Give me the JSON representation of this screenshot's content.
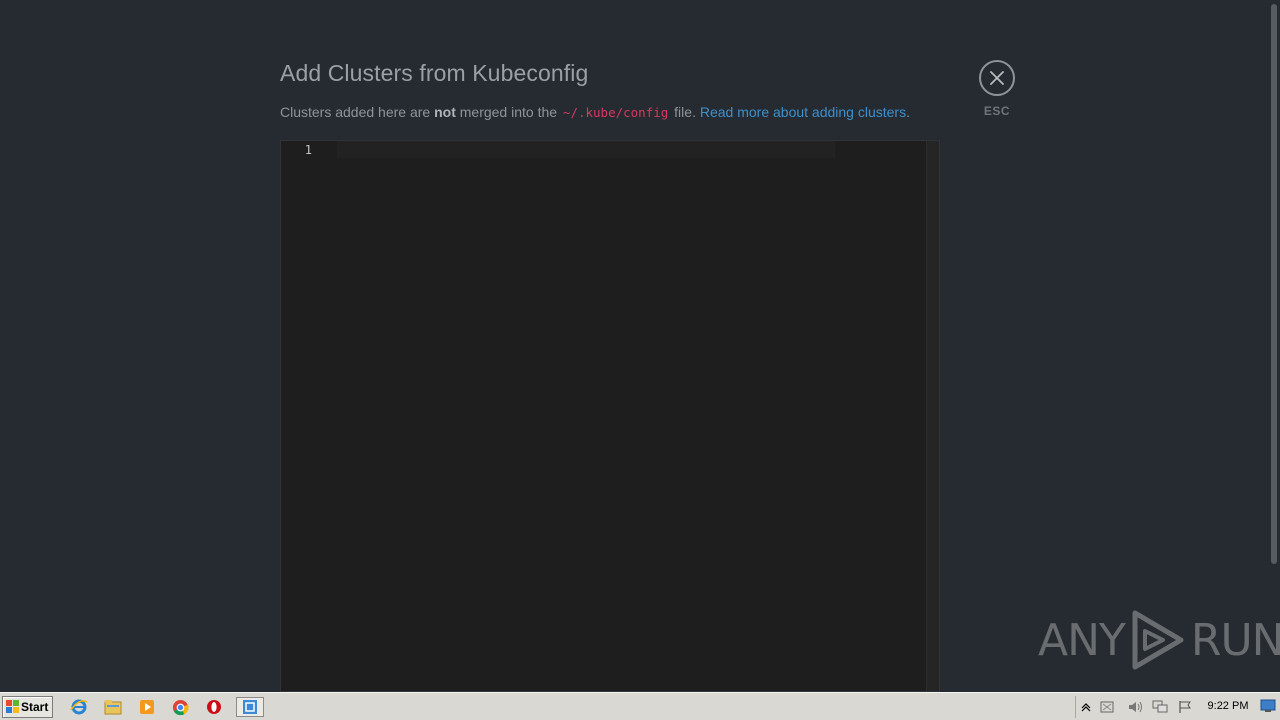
{
  "dialog": {
    "title": "Add Clusters from Kubeconfig",
    "subtitle_prefix": "Clusters added here are ",
    "subtitle_emphasis": "not",
    "subtitle_middle": " merged into the ",
    "config_path": "~/.kube/config",
    "subtitle_suffix": " file. ",
    "read_more_link": "Read more about adding clusters",
    "subtitle_end": ".",
    "close_icon": "close-icon",
    "esc_label": "ESC"
  },
  "editor": {
    "line_numbers": [
      "1"
    ],
    "content": ""
  },
  "watermark": {
    "left_text": "ANY",
    "right_text": "RUN"
  },
  "taskbar": {
    "start_label": "Start",
    "pinned": [
      {
        "name": "internet-explorer-icon",
        "active": false
      },
      {
        "name": "file-explorer-icon",
        "active": false
      },
      {
        "name": "media-player-icon",
        "active": false
      },
      {
        "name": "chrome-icon",
        "active": false
      },
      {
        "name": "opera-icon",
        "active": false
      },
      {
        "name": "lens-app-icon",
        "active": true
      }
    ],
    "tray_icons": [
      "show-hidden-icons-icon",
      "action-center-icon",
      "volume-icon",
      "network-icon",
      "flag-icon"
    ],
    "clock": "9:22 PM"
  },
  "colors": {
    "background": "#262b31",
    "editor_background": "#1e1e1e",
    "link": "#3d90ce",
    "code": "#d7385f"
  }
}
